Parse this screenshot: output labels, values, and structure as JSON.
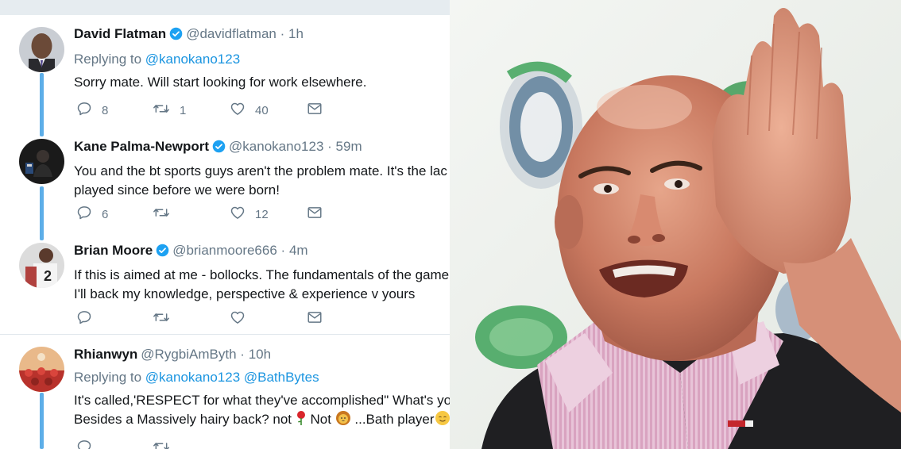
{
  "tweets": [
    {
      "name": "David Flatman",
      "handle": "@davidflatman",
      "time": "1h",
      "replying_prefix": "Replying to",
      "replying_to": "@kanokano123",
      "text_lines": [
        "Sorry mate. Will start looking for work elsewhere."
      ],
      "replies": "8",
      "retweets": "1",
      "likes": "40",
      "verified": true
    },
    {
      "name": "Kane Palma-Newport",
      "handle": "@kanokano123",
      "time": "59m",
      "text_lines": [
        "You and the bt sports guys aren't the problem mate. It's the lac",
        "played since before we were born!"
      ],
      "replies": "6",
      "retweets": "",
      "likes": "12",
      "verified": true
    },
    {
      "name": "Brian Moore",
      "handle": "@brianmoore666",
      "time": "4m",
      "text_lines": [
        "If this is aimed at me - bollocks. The fundamentals of the game",
        "I'll back my knowledge, perspective & experience v yours"
      ],
      "replies": "",
      "retweets": "",
      "likes": "",
      "verified": true
    },
    {
      "name": "Rhianwyn",
      "handle": "@RygbiAmByth",
      "time": "10h",
      "replying_prefix": "Replying to",
      "replying_to": "@kanokano123 @BathBytes",
      "text_lines": [
        "It's called,'RESPECT for what they've accomplished\" What's yo"
      ],
      "text_line2_a": "Besides a Massively hairy back? not ",
      "text_line2_b": " Not ",
      "text_line2_c": " ...Bath player",
      "verified": false
    }
  ],
  "separator": "·",
  "icons": [
    "reply-icon",
    "retweet-icon",
    "like-icon",
    "direct-message-icon",
    "verified-badge-icon",
    "rose-emoji",
    "lion-emoji",
    "smiling-emoji"
  ],
  "colors": {
    "link": "#1b95e0",
    "muted": "#657786",
    "text": "#14171a",
    "thread_line": "#5daee8",
    "topbar": "#e6ecf0"
  }
}
